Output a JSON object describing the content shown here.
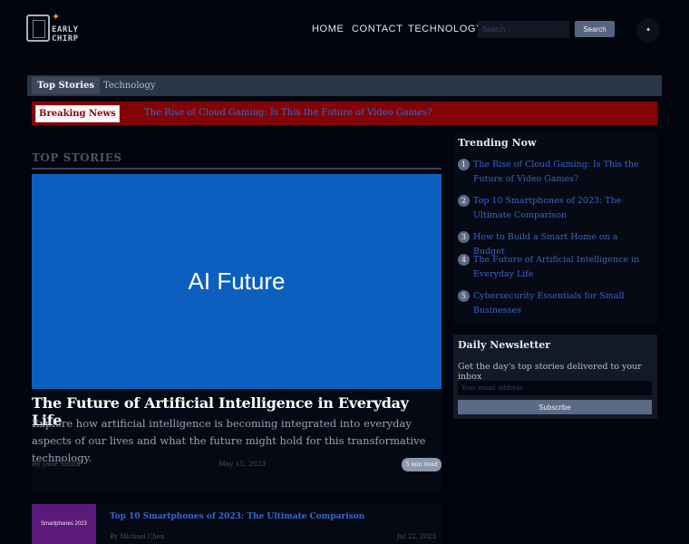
{
  "header": {
    "logo_text": "EARLY CHIRP",
    "nav": [
      "HOME",
      "CONTACT",
      "TECHNOLOGY"
    ],
    "search": {
      "placeholder": "Search",
      "button_label": "Search"
    },
    "theme_toggle_glyph": "✦"
  },
  "tabs": [
    "Top Stories",
    "Technology"
  ],
  "breaking": {
    "label": "Breaking News",
    "headline": "The Rise of Cloud Gaming: Is This the Future of Video Games?"
  },
  "top_stories": {
    "heading": "TOP STORIES",
    "featured": {
      "image_text": "AI Future",
      "title": "The Future of Artificial Intelligence in Everyday Life",
      "excerpt": "Explore how artificial intelligence is becoming integrated into everyday aspects of our lives and what the future might hold for this transformative technology.",
      "author": "By Jane Smith",
      "date": "May 15, 2023",
      "read_time": "5 min read"
    },
    "stories": [
      {
        "image_text": "Smartphones 2023",
        "title": "Top 10 Smartphones of 2023: The Ultimate Comparison",
        "author": "By Michael Chen",
        "date": "Jul 22, 2023"
      }
    ]
  },
  "trending": {
    "title": "Trending Now",
    "items": [
      {
        "number": "1",
        "title": "The Rise of Cloud Gaming: Is This the Future of Video Games?"
      },
      {
        "number": "2",
        "title": "Top 10 Smartphones of 2023: The Ultimate Comparison"
      },
      {
        "number": "3",
        "title": "How to Build a Smart Home on a Budget"
      },
      {
        "number": "4",
        "title": "The Future of Artificial Intelligence in Everyday Life"
      },
      {
        "number": "5",
        "title": "Cybersecurity Essentials for Small Businesses"
      }
    ]
  },
  "newsletter": {
    "title": "Daily Newsletter",
    "description": "Get the day's top stories delivered to your inbox",
    "email_placeholder": "Your email address",
    "button_label": "Subscribe"
  },
  "colors": {
    "background": "#02050d",
    "accent_link": "#3b66c4",
    "breaking_red": "#820406",
    "hero_blue": "#0c5fbe",
    "thumb_purple": "#5b1a7a"
  }
}
